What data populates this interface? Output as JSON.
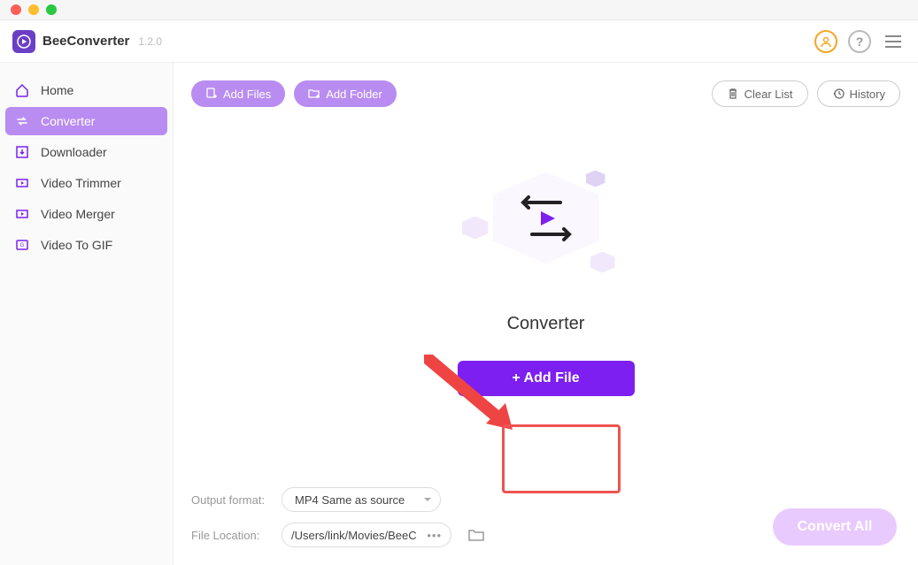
{
  "app": {
    "name": "BeeConverter",
    "version": "1.2.0"
  },
  "sidebar": {
    "items": [
      {
        "label": "Home",
        "icon": "home-icon"
      },
      {
        "label": "Converter",
        "icon": "converter-icon",
        "active": true
      },
      {
        "label": "Downloader",
        "icon": "downloader-icon"
      },
      {
        "label": "Video Trimmer",
        "icon": "trimmer-icon"
      },
      {
        "label": "Video Merger",
        "icon": "merger-icon"
      },
      {
        "label": "Video To GIF",
        "icon": "gif-icon"
      }
    ]
  },
  "toolbar": {
    "add_files": "Add Files",
    "add_folder": "Add Folder",
    "clear_list": "Clear List",
    "history": "History"
  },
  "center": {
    "heading": "Converter",
    "add_file_btn": "+ Add File"
  },
  "bottom": {
    "output_format_label": "Output format:",
    "output_format_value": "MP4 Same as source",
    "file_location_label": "File Location:",
    "file_location_value": "/Users/link/Movies/BeeC",
    "convert_all": "Convert All"
  }
}
